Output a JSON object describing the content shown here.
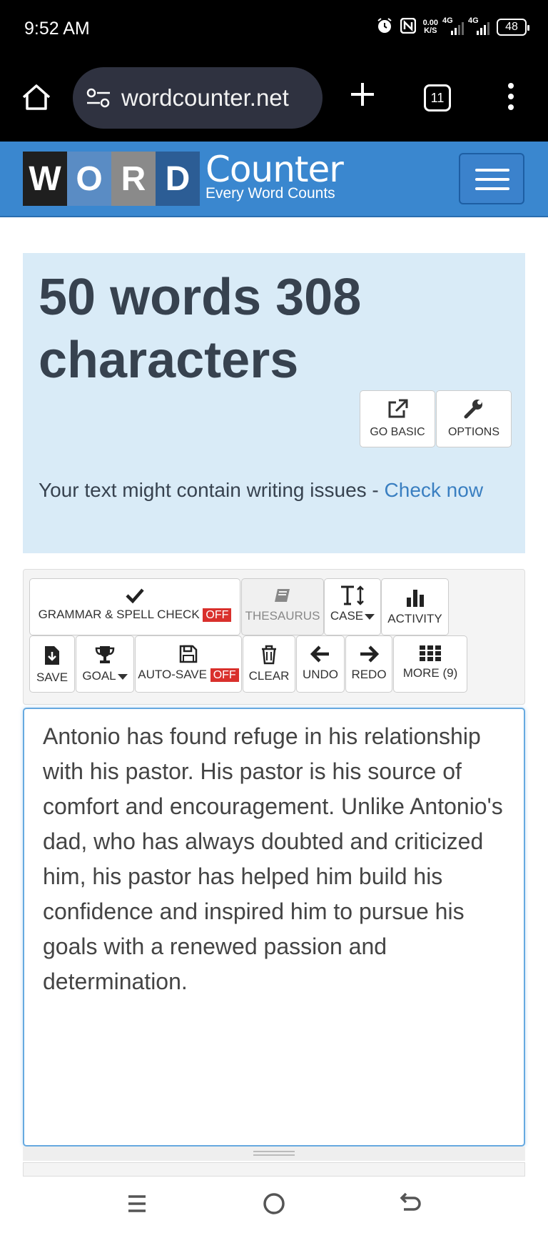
{
  "status_bar": {
    "time": "9:52 AM",
    "net_speed_value": "0.00",
    "net_speed_unit": "K/S",
    "signal1": "4G",
    "signal2": "4G",
    "battery": "48"
  },
  "browser": {
    "url": "wordcounter.net",
    "tab_count": "11"
  },
  "header": {
    "logo_letters": [
      "W",
      "O",
      "R",
      "D"
    ],
    "logo_word": "Counter",
    "logo_tagline": "Every Word Counts"
  },
  "summary": {
    "count_title": "50 words 308 characters",
    "go_basic_label": "GO BASIC",
    "options_label": "OPTIONS",
    "issues_text": "Your text might contain writing issues - ",
    "issues_link": "Check now"
  },
  "toolbar": {
    "grammar_label": "GRAMMAR & SPELL CHECK",
    "grammar_state": "OFF",
    "thesaurus_label": "THESAURUS",
    "case_label": "CASE",
    "activity_label": "ACTIVITY",
    "save_label": "SAVE",
    "goal_label": "GOAL",
    "autosave_label": "AUTO-SAVE",
    "autosave_state": "OFF",
    "clear_label": "CLEAR",
    "undo_label": "UNDO",
    "redo_label": "REDO",
    "more_label": "MORE (9)"
  },
  "editor": {
    "text": "Antonio has found refuge in his relationship with his pastor. His pastor is his source of comfort and encouragement. Unlike Antonio's dad, who has always doubted and criticized him, his pastor has helped him build his confidence and inspired him to pursue his goals with a renewed passion and determination."
  },
  "colors": {
    "header_blue": "#3a87cf",
    "summary_bg": "#d9ebf7",
    "off_red": "#d9302c",
    "link_blue": "#3a7fc1"
  }
}
